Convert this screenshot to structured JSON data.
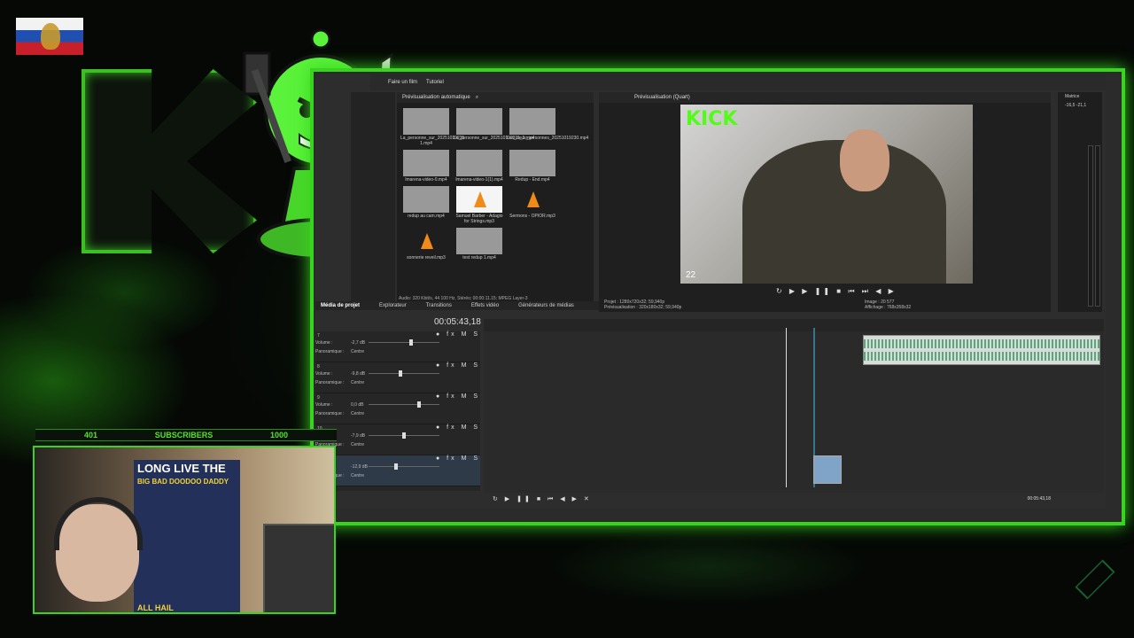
{
  "overlay": {
    "subscribers_label": "SUBSCRIBERS",
    "subscribers_current": "401",
    "subscribers_goal": "1000",
    "subscribers_progress": 0.401,
    "poster_line1": "LONG LIVE THE",
    "poster_line2": "BIG BAD DOODOO DADDY",
    "poster_line3": "ALL HAIL",
    "accent_color": "#38d41e"
  },
  "toolbar": {
    "make_movie": "Faire un film",
    "tutorial": "Tutoriel"
  },
  "media": {
    "auto_preview": "Prévisualisation automatique",
    "items": [
      {
        "name": "La_personne_sur_20251019231​1.mp4",
        "thumb": "video"
      },
      {
        "name": "La_personne_sur_202510192311_1.mp4",
        "thumb": "video"
      },
      {
        "name": "Les_deux_personnes_20251019230.mp4",
        "thumb": "video"
      },
      {
        "name": "lmarena-video-0.mp4",
        "thumb": "video"
      },
      {
        "name": "lmarena-video-1(1).mp4",
        "thumb": "video"
      },
      {
        "name": "Redup - End.mp4",
        "thumb": "video"
      },
      {
        "name": "redup au cam.mp4",
        "thumb": "video"
      },
      {
        "name": "Samuel Barber - Adagio for Strings.mp3",
        "thumb": "cone"
      },
      {
        "name": "Sermons - OPIOR.mp3",
        "thumb": "cone"
      },
      {
        "name": "sonnerie reveil.mp3",
        "thumb": "cone"
      },
      {
        "name": "test redup 1.mp4",
        "thumb": "video"
      }
    ],
    "status": "Audio: 320 Kbit/s, 44 100 Hz, Stéréo; 00:00:11.15; MPEG Layer-3",
    "tabs": [
      "Média de projet",
      "Explorateur",
      "Transitions",
      "Effets vidéo",
      "Générateurs de médias"
    ]
  },
  "preview": {
    "label": "Prévisualisation (Quart)",
    "kick_text": "KICK",
    "viewers": "22",
    "project_label": "Projet :",
    "project_value": "1280x720x32; 59,940p",
    "preview_label": "Prévisualisation :",
    "preview_value": "320x180x32; 59,940p",
    "image_label": "Image :",
    "image_value": "20 577",
    "display_label": "Affichage :",
    "display_value": "768x358x32"
  },
  "meter": {
    "label": "Matrice",
    "left_peak": "-16,5",
    "right_peak": "-21,1"
  },
  "timeline": {
    "timecode": "00:05:43,18",
    "bottom_timecode": "00:05:43,18",
    "tracks": [
      {
        "num": "7",
        "volume": "-2,7 dB",
        "pan": "Centre",
        "vol_pos": 0.6
      },
      {
        "num": "8",
        "volume": "-9,8 dB",
        "pan": "Centre",
        "vol_pos": 0.45
      },
      {
        "num": "9",
        "volume": "0,0 dB",
        "pan": "Centre",
        "vol_pos": 0.72
      },
      {
        "num": "10",
        "volume": "-7,9 dB",
        "pan": "Centre",
        "vol_pos": 0.5
      },
      {
        "num": "11",
        "volume": "-12,9 dB",
        "pan": "Centre",
        "vol_pos": 0.38
      }
    ],
    "volume_label": "Volume :",
    "pan_label": "Panoramique :"
  }
}
